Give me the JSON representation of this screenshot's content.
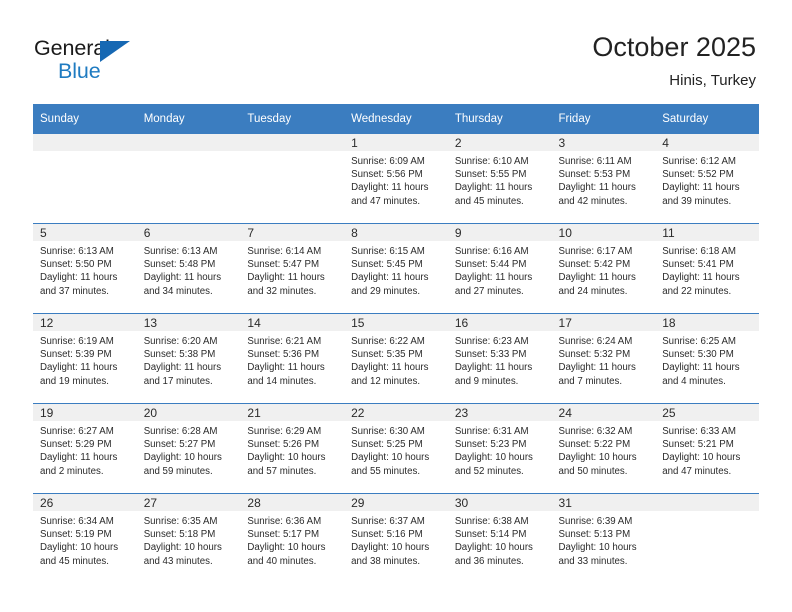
{
  "logo": {
    "line1": "General",
    "line2": "Blue",
    "triangle_icon": "triangle-icon",
    "color_dark": "#1a1a1a",
    "color_blue": "#1f7bc1",
    "triangle_color": "#1668b3"
  },
  "header": {
    "title": "October 2025",
    "location": "Hinis, Turkey"
  },
  "theme": {
    "header_bg": "#3b7dc0",
    "daynum_bg": "#f0f0f0",
    "text": "#2b2b2b"
  },
  "weekdays": [
    "Sunday",
    "Monday",
    "Tuesday",
    "Wednesday",
    "Thursday",
    "Friday",
    "Saturday"
  ],
  "weeks": [
    [
      {
        "day": "",
        "empty": true
      },
      {
        "day": "",
        "empty": true
      },
      {
        "day": "",
        "empty": true
      },
      {
        "day": "1",
        "sunrise": "Sunrise: 6:09 AM",
        "sunset": "Sunset: 5:56 PM",
        "daylight1": "Daylight: 11 hours",
        "daylight2": "and 47 minutes."
      },
      {
        "day": "2",
        "sunrise": "Sunrise: 6:10 AM",
        "sunset": "Sunset: 5:55 PM",
        "daylight1": "Daylight: 11 hours",
        "daylight2": "and 45 minutes."
      },
      {
        "day": "3",
        "sunrise": "Sunrise: 6:11 AM",
        "sunset": "Sunset: 5:53 PM",
        "daylight1": "Daylight: 11 hours",
        "daylight2": "and 42 minutes."
      },
      {
        "day": "4",
        "sunrise": "Sunrise: 6:12 AM",
        "sunset": "Sunset: 5:52 PM",
        "daylight1": "Daylight: 11 hours",
        "daylight2": "and 39 minutes."
      }
    ],
    [
      {
        "day": "5",
        "sunrise": "Sunrise: 6:13 AM",
        "sunset": "Sunset: 5:50 PM",
        "daylight1": "Daylight: 11 hours",
        "daylight2": "and 37 minutes."
      },
      {
        "day": "6",
        "sunrise": "Sunrise: 6:13 AM",
        "sunset": "Sunset: 5:48 PM",
        "daylight1": "Daylight: 11 hours",
        "daylight2": "and 34 minutes."
      },
      {
        "day": "7",
        "sunrise": "Sunrise: 6:14 AM",
        "sunset": "Sunset: 5:47 PM",
        "daylight1": "Daylight: 11 hours",
        "daylight2": "and 32 minutes."
      },
      {
        "day": "8",
        "sunrise": "Sunrise: 6:15 AM",
        "sunset": "Sunset: 5:45 PM",
        "daylight1": "Daylight: 11 hours",
        "daylight2": "and 29 minutes."
      },
      {
        "day": "9",
        "sunrise": "Sunrise: 6:16 AM",
        "sunset": "Sunset: 5:44 PM",
        "daylight1": "Daylight: 11 hours",
        "daylight2": "and 27 minutes."
      },
      {
        "day": "10",
        "sunrise": "Sunrise: 6:17 AM",
        "sunset": "Sunset: 5:42 PM",
        "daylight1": "Daylight: 11 hours",
        "daylight2": "and 24 minutes."
      },
      {
        "day": "11",
        "sunrise": "Sunrise: 6:18 AM",
        "sunset": "Sunset: 5:41 PM",
        "daylight1": "Daylight: 11 hours",
        "daylight2": "and 22 minutes."
      }
    ],
    [
      {
        "day": "12",
        "sunrise": "Sunrise: 6:19 AM",
        "sunset": "Sunset: 5:39 PM",
        "daylight1": "Daylight: 11 hours",
        "daylight2": "and 19 minutes."
      },
      {
        "day": "13",
        "sunrise": "Sunrise: 6:20 AM",
        "sunset": "Sunset: 5:38 PM",
        "daylight1": "Daylight: 11 hours",
        "daylight2": "and 17 minutes."
      },
      {
        "day": "14",
        "sunrise": "Sunrise: 6:21 AM",
        "sunset": "Sunset: 5:36 PM",
        "daylight1": "Daylight: 11 hours",
        "daylight2": "and 14 minutes."
      },
      {
        "day": "15",
        "sunrise": "Sunrise: 6:22 AM",
        "sunset": "Sunset: 5:35 PM",
        "daylight1": "Daylight: 11 hours",
        "daylight2": "and 12 minutes."
      },
      {
        "day": "16",
        "sunrise": "Sunrise: 6:23 AM",
        "sunset": "Sunset: 5:33 PM",
        "daylight1": "Daylight: 11 hours",
        "daylight2": "and 9 minutes."
      },
      {
        "day": "17",
        "sunrise": "Sunrise: 6:24 AM",
        "sunset": "Sunset: 5:32 PM",
        "daylight1": "Daylight: 11 hours",
        "daylight2": "and 7 minutes."
      },
      {
        "day": "18",
        "sunrise": "Sunrise: 6:25 AM",
        "sunset": "Sunset: 5:30 PM",
        "daylight1": "Daylight: 11 hours",
        "daylight2": "and 4 minutes."
      }
    ],
    [
      {
        "day": "19",
        "sunrise": "Sunrise: 6:27 AM",
        "sunset": "Sunset: 5:29 PM",
        "daylight1": "Daylight: 11 hours",
        "daylight2": "and 2 minutes."
      },
      {
        "day": "20",
        "sunrise": "Sunrise: 6:28 AM",
        "sunset": "Sunset: 5:27 PM",
        "daylight1": "Daylight: 10 hours",
        "daylight2": "and 59 minutes."
      },
      {
        "day": "21",
        "sunrise": "Sunrise: 6:29 AM",
        "sunset": "Sunset: 5:26 PM",
        "daylight1": "Daylight: 10 hours",
        "daylight2": "and 57 minutes."
      },
      {
        "day": "22",
        "sunrise": "Sunrise: 6:30 AM",
        "sunset": "Sunset: 5:25 PM",
        "daylight1": "Daylight: 10 hours",
        "daylight2": "and 55 minutes."
      },
      {
        "day": "23",
        "sunrise": "Sunrise: 6:31 AM",
        "sunset": "Sunset: 5:23 PM",
        "daylight1": "Daylight: 10 hours",
        "daylight2": "and 52 minutes."
      },
      {
        "day": "24",
        "sunrise": "Sunrise: 6:32 AM",
        "sunset": "Sunset: 5:22 PM",
        "daylight1": "Daylight: 10 hours",
        "daylight2": "and 50 minutes."
      },
      {
        "day": "25",
        "sunrise": "Sunrise: 6:33 AM",
        "sunset": "Sunset: 5:21 PM",
        "daylight1": "Daylight: 10 hours",
        "daylight2": "and 47 minutes."
      }
    ],
    [
      {
        "day": "26",
        "sunrise": "Sunrise: 6:34 AM",
        "sunset": "Sunset: 5:19 PM",
        "daylight1": "Daylight: 10 hours",
        "daylight2": "and 45 minutes."
      },
      {
        "day": "27",
        "sunrise": "Sunrise: 6:35 AM",
        "sunset": "Sunset: 5:18 PM",
        "daylight1": "Daylight: 10 hours",
        "daylight2": "and 43 minutes."
      },
      {
        "day": "28",
        "sunrise": "Sunrise: 6:36 AM",
        "sunset": "Sunset: 5:17 PM",
        "daylight1": "Daylight: 10 hours",
        "daylight2": "and 40 minutes."
      },
      {
        "day": "29",
        "sunrise": "Sunrise: 6:37 AM",
        "sunset": "Sunset: 5:16 PM",
        "daylight1": "Daylight: 10 hours",
        "daylight2": "and 38 minutes."
      },
      {
        "day": "30",
        "sunrise": "Sunrise: 6:38 AM",
        "sunset": "Sunset: 5:14 PM",
        "daylight1": "Daylight: 10 hours",
        "daylight2": "and 36 minutes."
      },
      {
        "day": "31",
        "sunrise": "Sunrise: 6:39 AM",
        "sunset": "Sunset: 5:13 PM",
        "daylight1": "Daylight: 10 hours",
        "daylight2": "and 33 minutes."
      },
      {
        "day": "",
        "empty": true
      }
    ]
  ]
}
